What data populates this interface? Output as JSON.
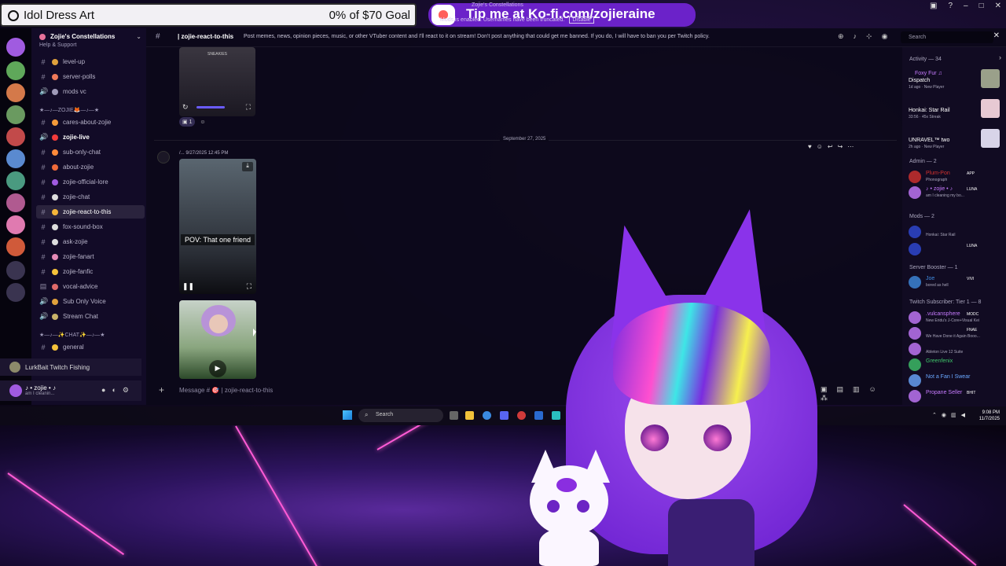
{
  "overlay": {
    "goal_title": "Idol Dress Art",
    "goal_progress": "0% of $70 Goal",
    "goal_percent": 0,
    "goal_amount": "$70",
    "kofi_text": "Tip me at Ko-fi.com/zojieraine",
    "notice_top": "Zojie's Constellations",
    "notice_bottom": "Mods is enabled. Usernames have been truncated.",
    "notice_button": "Disable"
  },
  "server": {
    "name": "Zojie's Constellations",
    "top_cutoff": "Help & Support"
  },
  "channels": [
    {
      "prefix": "#",
      "label": "level-up",
      "color": "#e0a13c"
    },
    {
      "prefix": "#",
      "label": "server-polls",
      "color": "#f07a5a"
    },
    {
      "prefix": "🔊",
      "label": "mods vc",
      "color": "#9f9ab8"
    },
    {
      "prefix": "#",
      "label": "cares-about-zojie",
      "color": "#f59a3a"
    },
    {
      "prefix": "🔊",
      "label": "zojie-live",
      "color": "#f23b3b",
      "bold": true
    },
    {
      "prefix": "#",
      "label": "sub-only-chat",
      "color": "#ff8a3a"
    },
    {
      "prefix": "#",
      "label": "about-zojie",
      "color": "#f06a3a"
    },
    {
      "prefix": "#",
      "label": "zojie-official-lore",
      "color": "#a05be0"
    },
    {
      "prefix": "#",
      "label": "zojie-chat",
      "color": "#dddddd"
    },
    {
      "prefix": "#",
      "label": "zojie-react-to-this",
      "color": "#f5b63a",
      "active": true
    },
    {
      "prefix": "#",
      "label": "fox-sound-box",
      "color": "#ddd"
    },
    {
      "prefix": "#",
      "label": "ask-zojie",
      "color": "#ddd"
    },
    {
      "prefix": "#",
      "label": "zojie-fanart",
      "color": "#e58ab6"
    },
    {
      "prefix": "#",
      "label": "zojie-fanfic",
      "color": "#f5c23a"
    },
    {
      "prefix": "▤",
      "label": "vocal-advice",
      "color": "#e06a6a"
    },
    {
      "prefix": "🔊",
      "label": "Sub Only Voice",
      "color": "#e0a13c"
    },
    {
      "prefix": "🔊",
      "label": "Stream Chat",
      "color": "#c9b36a"
    },
    {
      "prefix": "#",
      "label": "general",
      "color": "#f5c23a"
    }
  ],
  "categories": {
    "zojie": "★—♪—ZOJIE🦊—♪—★",
    "chat": "★—♪—✨CHAT✨—♪—★"
  },
  "voice_card": "LurkBait Twitch Fishing",
  "user_panel": {
    "name": "♪ • zojie • ♪",
    "status": "am I cleanin..."
  },
  "header": {
    "channel": "| zojie-react-to-this",
    "topic": "Post memes, news, opinion pieces, music, or other VTuber content and I'll react to it on stream! Don't post anything that could get me banned. If you do, I will have to ban you per Twitch policy.",
    "search_placeholder": "Search"
  },
  "messages": {
    "reaction_count": "1",
    "date_divider": "September 27, 2025",
    "timestamp": "9/27/2025 12:45 PM",
    "author": "/...",
    "video_caption": "POV: That one friend",
    "video1_label": "SNEAKIES"
  },
  "composer": {
    "placeholder": "Message # 🎯 | zojie-react-to-this"
  },
  "members": {
    "activity_header": "Activity — 34",
    "activities": [
      {
        "name": "Foxy Fur ♫",
        "game": "Dispatch",
        "meta": "1d ago · New Player",
        "name_color": "#c77bff"
      },
      {
        "name": "",
        "game": "Honkai: Star Rail",
        "meta": "33:56 · 45x Streak",
        "name_color": "#7a6aff"
      },
      {
        "name": "",
        "game": "UNRAVEL™ two",
        "meta": "2h ago · New Player",
        "name_color": "#c9c9c9"
      }
    ],
    "admin_header": "Admin — 2",
    "admins": [
      {
        "name": "Plum-Pon",
        "badge": "APP",
        "sub": "Phonograph",
        "color": "#d4322f"
      },
      {
        "name": "♪ • zojie • ♪",
        "badge": "LUNA",
        "sub": "am I cleaning my bo...",
        "color": "#c77bff"
      }
    ],
    "mods_header": "Mods — 2",
    "mods": [
      {
        "name": "",
        "sub": "Honkai: Star Rail",
        "color": "#2f4ad8"
      },
      {
        "name": "",
        "badge": "LUNA",
        "sub": "",
        "color": "#2f4ad8"
      }
    ],
    "booster_header": "Server Booster — 1",
    "boosters": [
      {
        "name": "Joe",
        "badge": "VIVI",
        "sub": "bored as hell",
        "color": "#3f8be0"
      }
    ],
    "subs_header": "Twitch Subscriber: Tier 1 — 8",
    "subs": [
      {
        "name": ".vulcansphere",
        "badge": "MODC",
        "sub": "New Eridu's J-Core+Visual Kei",
        "color": "#c77bff"
      },
      {
        "name": "",
        "badge": "FNAE",
        "sub": "We Have Done it Again Booo...",
        "color": "#c77bff"
      },
      {
        "name": "",
        "badge": "",
        "sub": "Ableton Live 12 Suite",
        "color": "#c77bff"
      },
      {
        "name": "Greenfenix",
        "badge": "",
        "sub": "",
        "color": "#3fc46a"
      },
      {
        "name": "Not a Fan I Swear",
        "badge": "",
        "sub": "",
        "color": "#6aa8ff"
      },
      {
        "name": "Propane Seller",
        "badge": "BHIT",
        "sub": "",
        "color": "#c77bff"
      }
    ]
  },
  "taskbar": {
    "search_placeholder": "Search",
    "time": "9:08 PM",
    "date": "11/7/2025"
  },
  "colors": {
    "accent": "#6b22c9",
    "kofi_heart": "#ff5e5b",
    "streak": "#ff5bd6"
  }
}
